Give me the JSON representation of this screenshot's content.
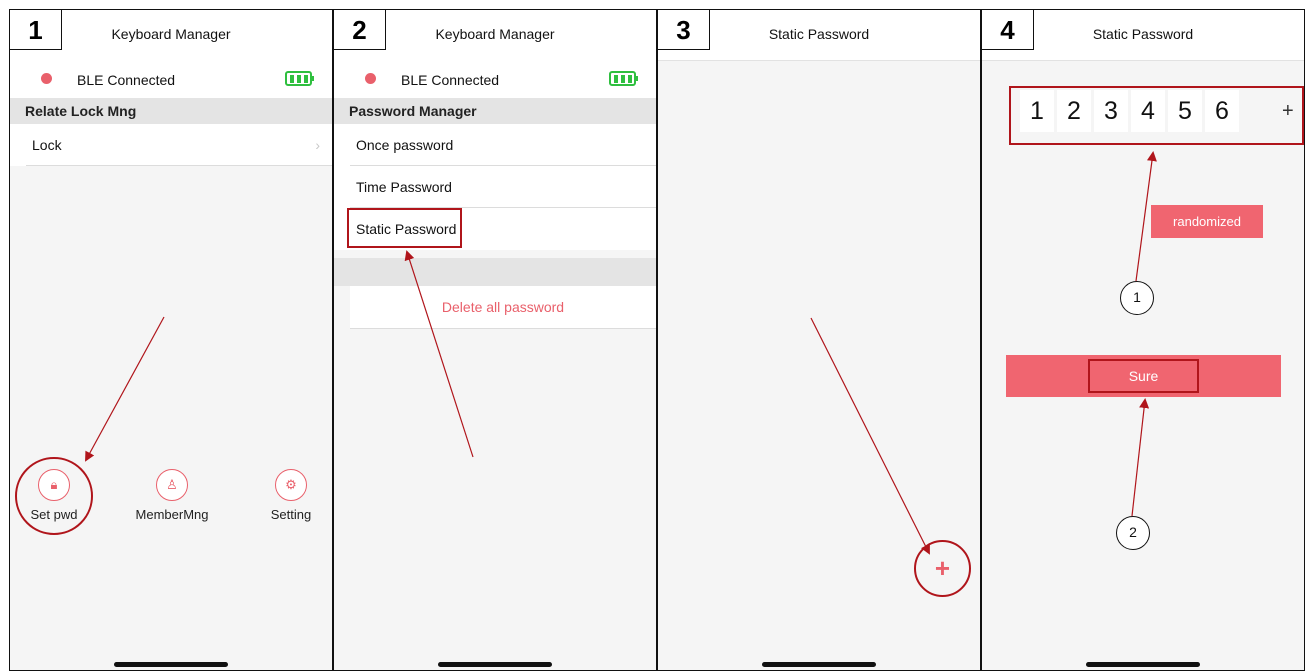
{
  "steps": [
    "1",
    "2",
    "3",
    "4"
  ],
  "panel1": {
    "title": "Keyboard Manager",
    "ble_status": "BLE Connected",
    "section": "Relate Lock Mng",
    "rows": [
      {
        "label": "Lock",
        "chevron": "›"
      }
    ],
    "tabs": [
      {
        "label": "Set pwd",
        "icon": "lock-icon",
        "glyph": "🔒︎"
      },
      {
        "label": "MemberMng",
        "icon": "members-icon",
        "glyph": "♙"
      },
      {
        "label": "Setting",
        "icon": "gear-icon",
        "glyph": "⚙"
      }
    ]
  },
  "panel2": {
    "title": "Keyboard Manager",
    "ble_status": "BLE Connected",
    "section": "Password Manager",
    "rows": [
      {
        "label": "Once password"
      },
      {
        "label": "Time Password"
      },
      {
        "label": "Static Password"
      }
    ],
    "delete_label": "Delete all password"
  },
  "panel3": {
    "title": "Static Password",
    "add_label": "+"
  },
  "panel4": {
    "title": "Static Password",
    "digits": [
      "1",
      "2",
      "3",
      "4",
      "5",
      "6"
    ],
    "add_digit": "+",
    "randomize_label": "randomized",
    "sure_label": "Sure",
    "callouts": [
      "1",
      "2"
    ]
  },
  "colors": {
    "accent": "#f06570",
    "highlight": "#b0151b",
    "battery": "#2fbf3f"
  }
}
